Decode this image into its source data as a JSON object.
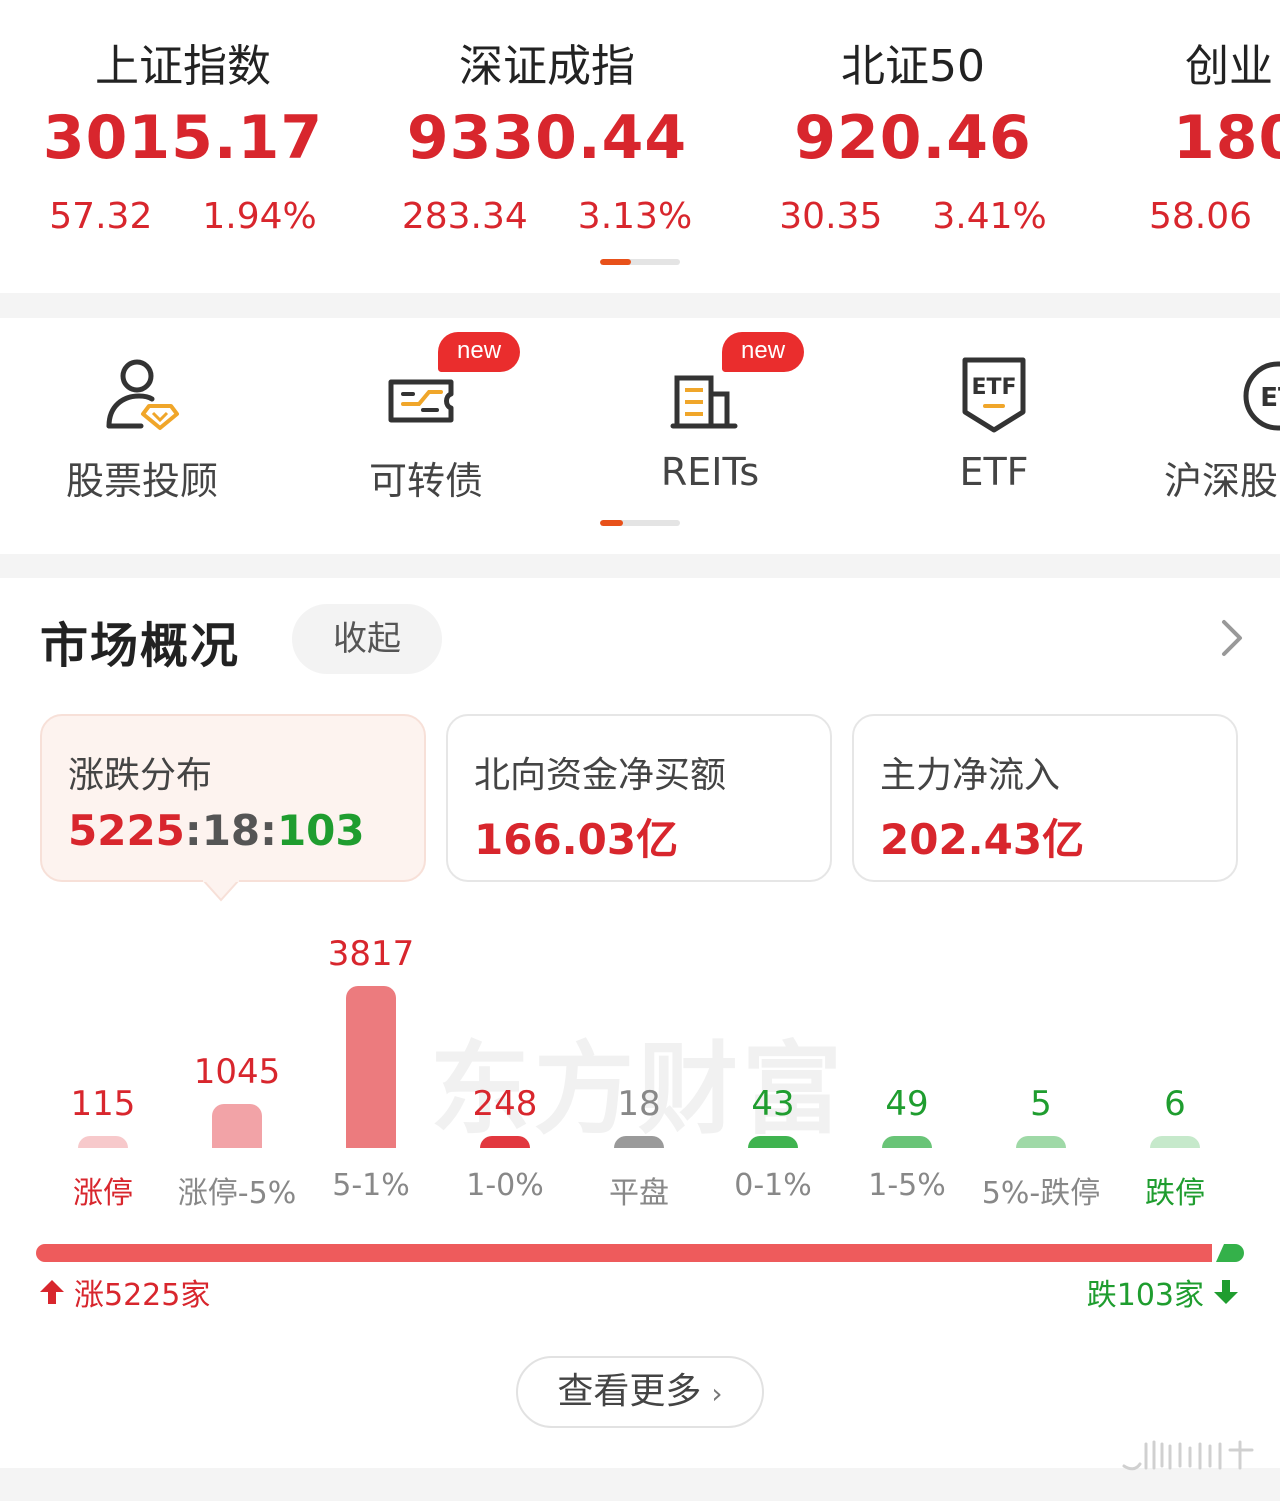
{
  "indices": [
    {
      "name": "上证指数",
      "value": "3015.17",
      "change": "57.32",
      "pct": "1.94%"
    },
    {
      "name": "深证成指",
      "value": "9330.44",
      "change": "283.34",
      "pct": "3.13%"
    },
    {
      "name": "北证50",
      "value": "920.46",
      "change": "30.35",
      "pct": "3.41%"
    },
    {
      "name": "创业",
      "value": "180",
      "change": "58.06",
      "pct": ""
    }
  ],
  "shortcuts": [
    {
      "label": "股票投顾",
      "icon": "advisor-icon",
      "badge": ""
    },
    {
      "label": "可转债",
      "icon": "convertible-bond-icon",
      "badge": "new"
    },
    {
      "label": "REITs",
      "icon": "reits-building-icon",
      "badge": "new"
    },
    {
      "label": "ETF",
      "icon": "etf-shield-icon",
      "badge": ""
    },
    {
      "label": "沪深股",
      "icon": "hs-stock-icon",
      "badge": ""
    }
  ],
  "overview": {
    "title": "市场概况",
    "collapse_label": "收起",
    "cards": [
      {
        "label": "涨跌分布",
        "up": "5225",
        "sep1": ":",
        "flat": "18",
        "sep2": ":",
        "down": "103"
      },
      {
        "label": "北向资金净买额",
        "value": "166.03亿"
      },
      {
        "label": "主力净流入",
        "value": "202.43亿"
      }
    ],
    "watermark": "东方财富",
    "distribution": [
      {
        "label": "涨停",
        "count": 115,
        "count_text": "115",
        "kind": "up"
      },
      {
        "label": "涨停-5%",
        "count": 1045,
        "count_text": "1045",
        "kind": "up"
      },
      {
        "label": "5-1%",
        "count": 3817,
        "count_text": "3817",
        "kind": "up"
      },
      {
        "label": "1-0%",
        "count": 248,
        "count_text": "248",
        "kind": "up"
      },
      {
        "label": "平盘",
        "count": 18,
        "count_text": "18",
        "kind": "flat"
      },
      {
        "label": "0-1%",
        "count": 43,
        "count_text": "43",
        "kind": "down"
      },
      {
        "label": "1-5%",
        "count": 49,
        "count_text": "49",
        "kind": "down"
      },
      {
        "label": "5%-跌停",
        "count": 5,
        "count_text": "5",
        "kind": "down"
      },
      {
        "label": "跌停",
        "count": 6,
        "count_text": "6",
        "kind": "down"
      }
    ],
    "ratio": {
      "up_count": 5225,
      "down_count": 103
    },
    "up_text": "涨5225家",
    "down_text": "跌103家",
    "more_label": "查看更多"
  },
  "colors": {
    "up_red": "#d8262d",
    "down_green": "#1f9d2f",
    "accent_orange": "#e8511a",
    "badge_red": "#ea2d2d"
  }
}
